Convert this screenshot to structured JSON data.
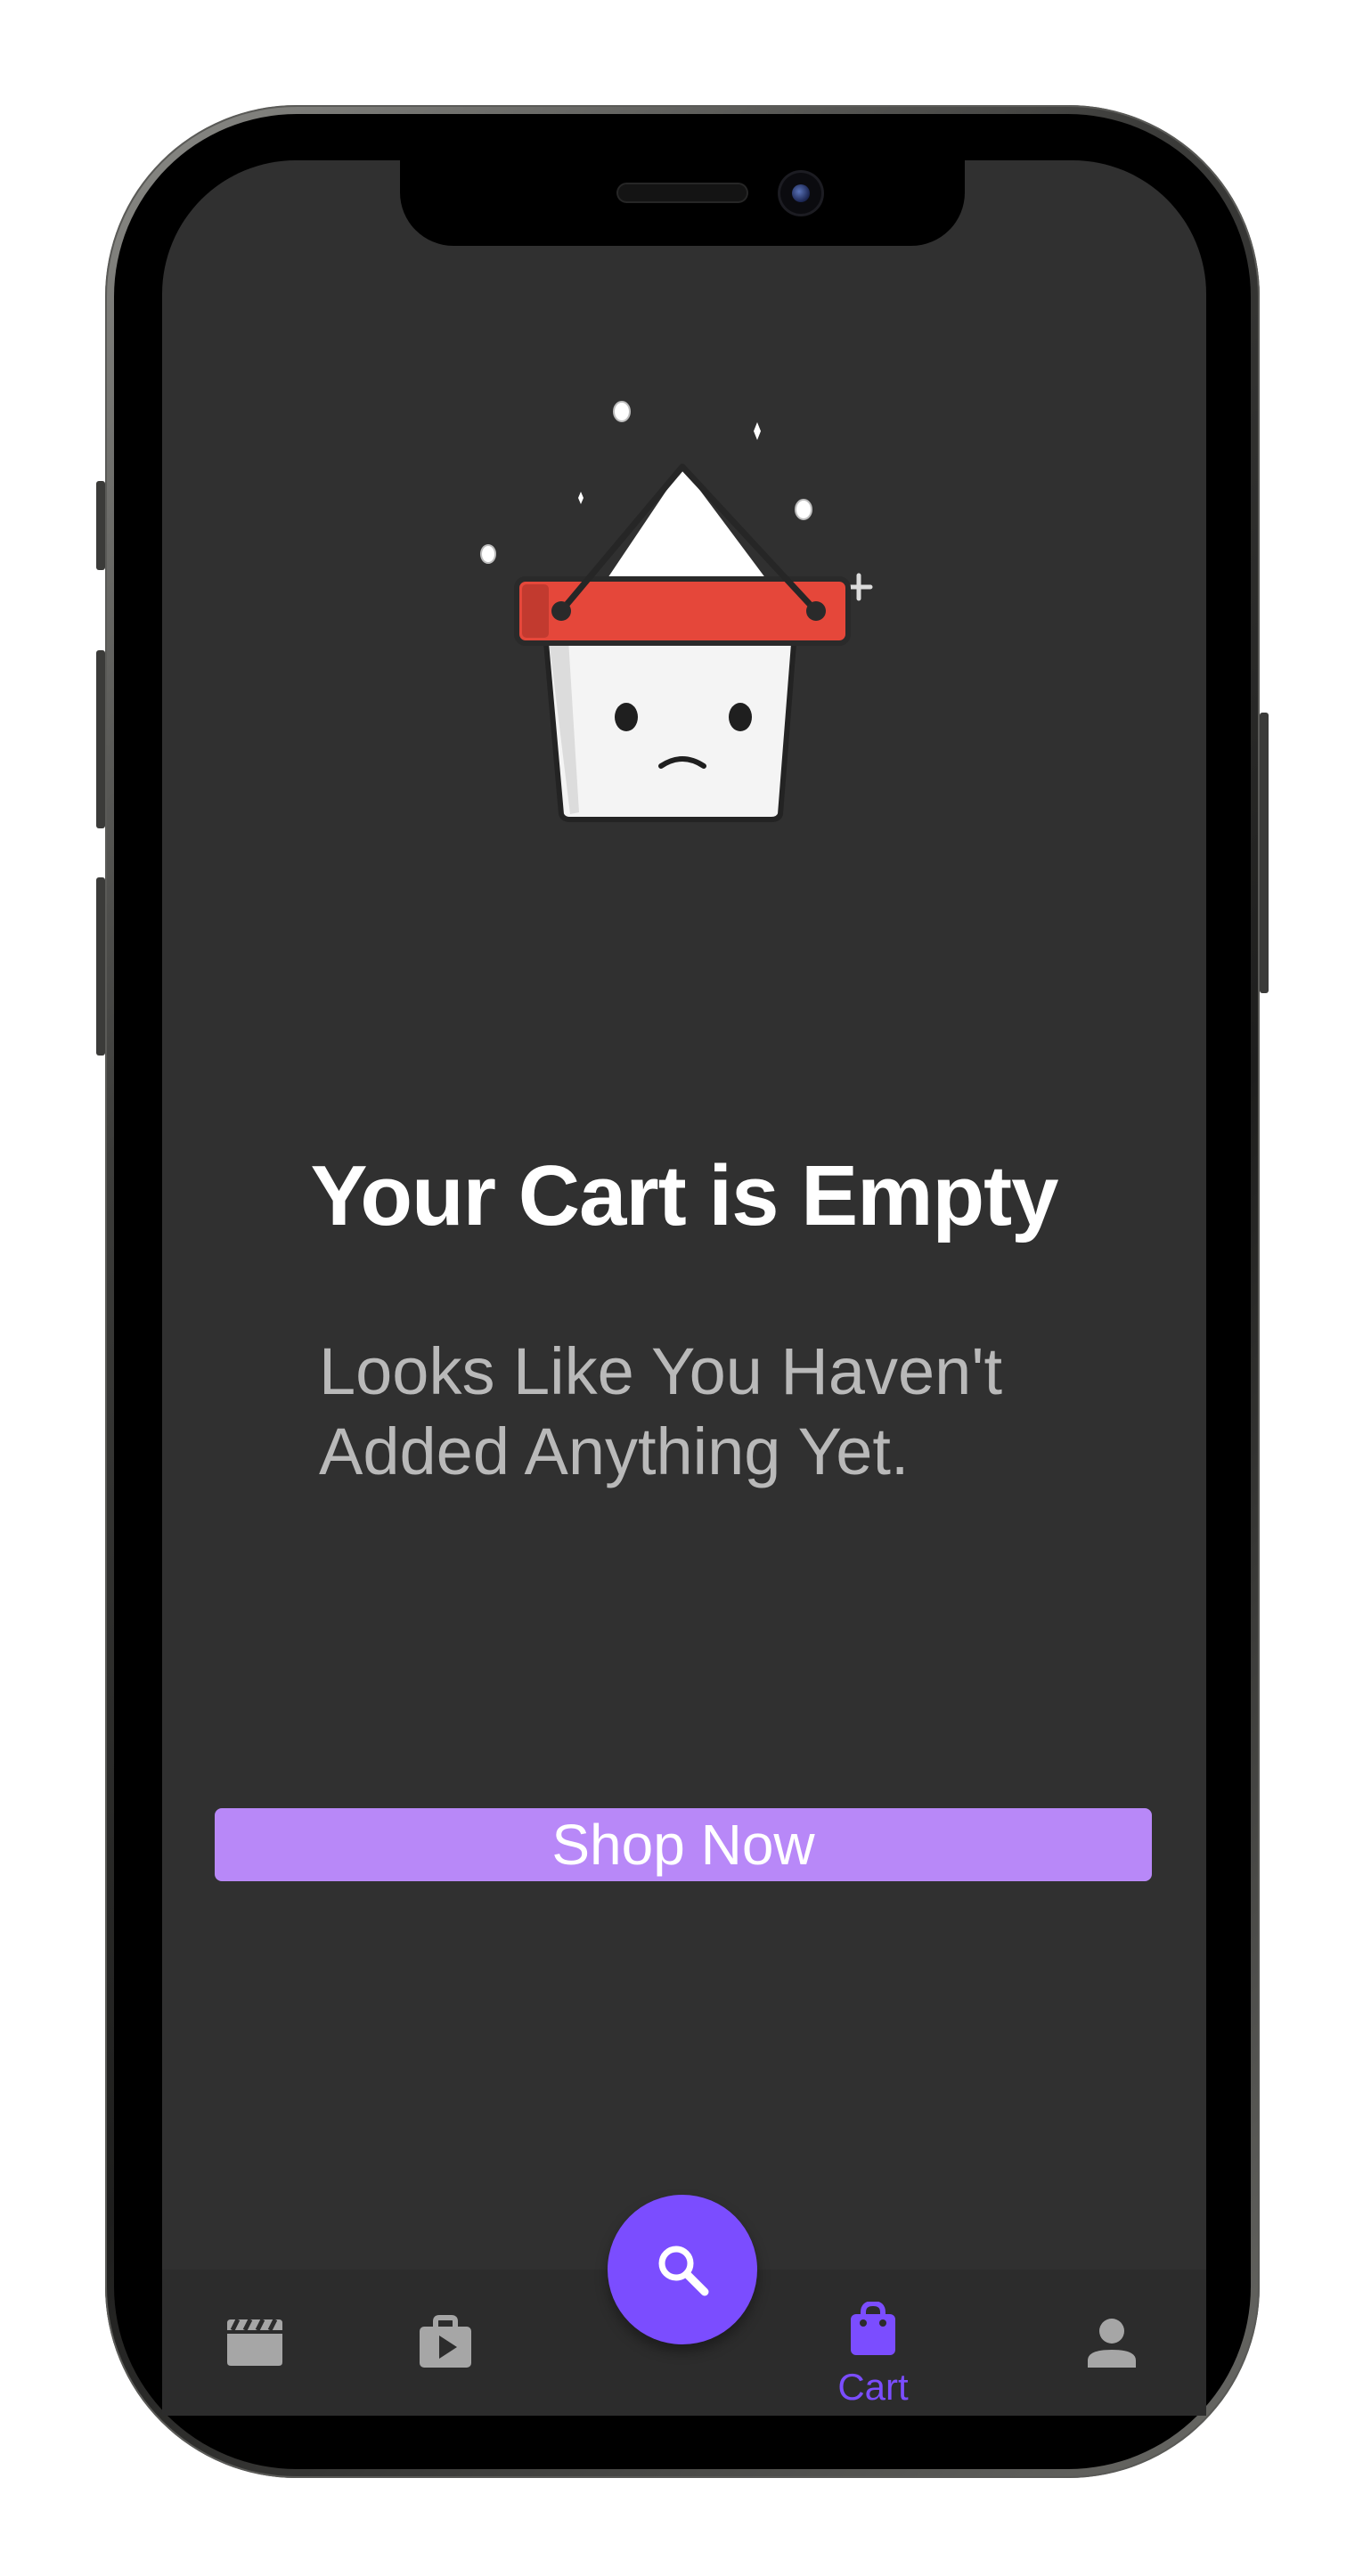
{
  "cart": {
    "title": "Your Cart is Empty",
    "message": "Looks Like You Haven't\n Added Anything Yet.",
    "shop_now_label": "Shop Now"
  },
  "bottom_nav": {
    "items": [
      {
        "icon": "movie-clapper-icon",
        "label": "",
        "active": false
      },
      {
        "icon": "play-bag-icon",
        "label": "",
        "active": false
      },
      {
        "icon": "search-icon",
        "label": "",
        "active": false
      },
      {
        "icon": "shopping-bag-icon",
        "label": "Cart",
        "active": true
      },
      {
        "icon": "person-icon",
        "label": "",
        "active": false
      }
    ]
  },
  "colors": {
    "background": "#303030",
    "accent": "#7b4dff",
    "button": "#b888f8",
    "inactive_icon": "#a6a6a6"
  }
}
